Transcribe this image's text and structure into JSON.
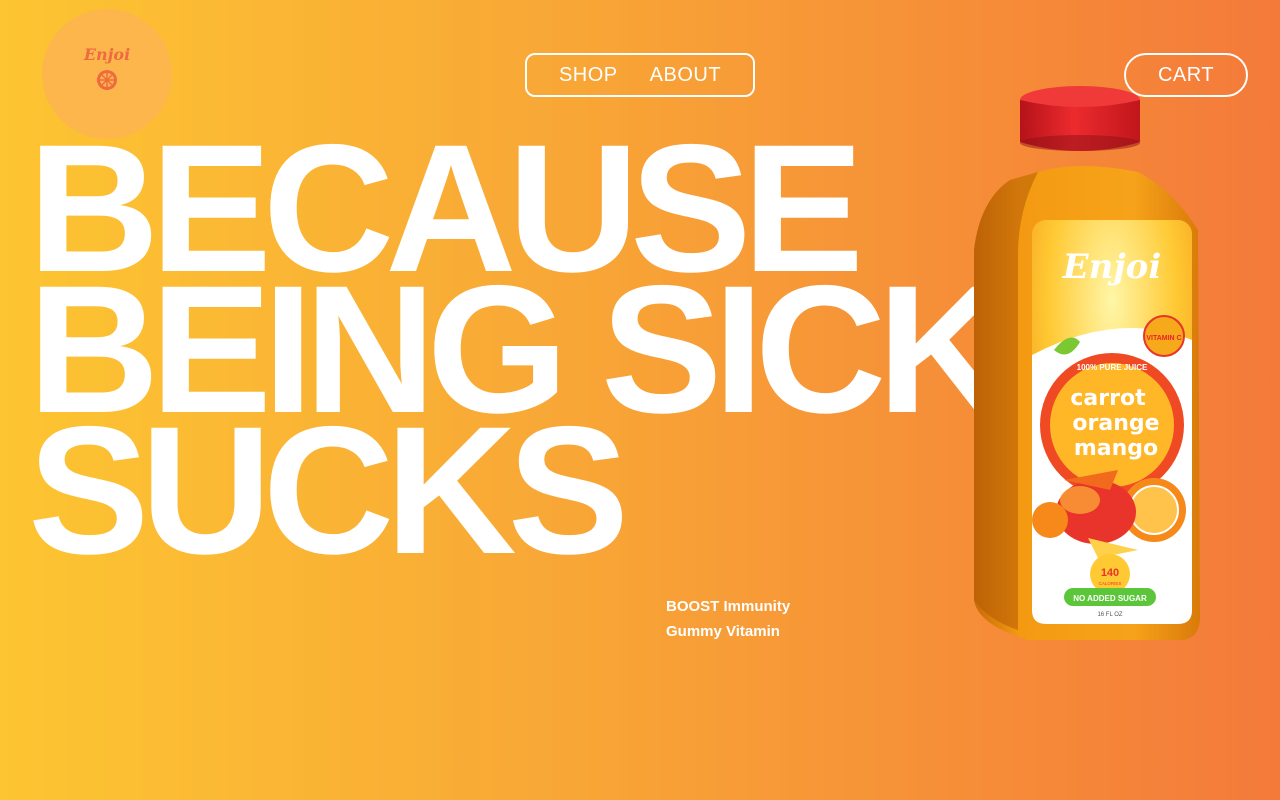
{
  "brand": {
    "name": "Enjoi",
    "icon": "orange-slice-icon"
  },
  "nav": {
    "items": [
      {
        "label": "SHOP"
      },
      {
        "label": "ABOUT"
      }
    ]
  },
  "cart": {
    "label": "CART"
  },
  "hero": {
    "lines": [
      "BECAUSE",
      "BEING SICK",
      "SUCKS"
    ]
  },
  "tagline": {
    "line1": "BOOST Immunity",
    "line2": "Gummy Vitamin"
  },
  "product": {
    "brand": "Enjoi",
    "badge": "VITAMIN C",
    "claim": "100% PURE JUICE",
    "flavor": [
      "carrot",
      "orange",
      "mango"
    ],
    "calories_value": "140",
    "calories_label": "CALORIES",
    "sugar_label": "NO ADDED SUGAR",
    "volume": "16 FL OZ"
  },
  "colors": {
    "gradient_start": "#fdc532",
    "gradient_end": "#f47a3a",
    "logo_circle": "#fdb64c",
    "logo_text": "#ef6a3f",
    "cap": "#e8242a"
  }
}
